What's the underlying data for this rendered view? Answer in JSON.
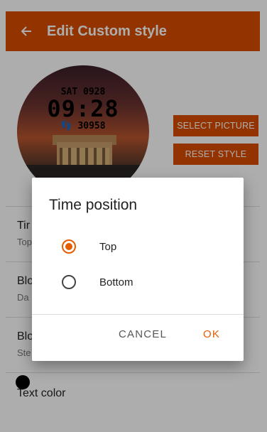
{
  "appbar": {
    "title": "Edit Custom style"
  },
  "preview": {
    "date": "SAT 0928",
    "time": "09:28",
    "steps": "30958"
  },
  "buttons": {
    "select_picture": "SELECT PICTURE",
    "reset_style": "RESET STYLE"
  },
  "settings": [
    {
      "title": "Tir",
      "subtitle": "Top"
    },
    {
      "title": "Blo",
      "subtitle": "Da"
    },
    {
      "title": "Blo",
      "subtitle": "Ste"
    }
  ],
  "text_color": {
    "label": "Text color",
    "value_color": "#000000"
  },
  "dialog": {
    "title": "Time position",
    "options": [
      {
        "label": "Top",
        "selected": true
      },
      {
        "label": "Bottom",
        "selected": false
      }
    ],
    "cancel": "CANCEL",
    "ok": "OK"
  },
  "colors": {
    "accent": "#d94d00",
    "radio": "#e65c00"
  }
}
